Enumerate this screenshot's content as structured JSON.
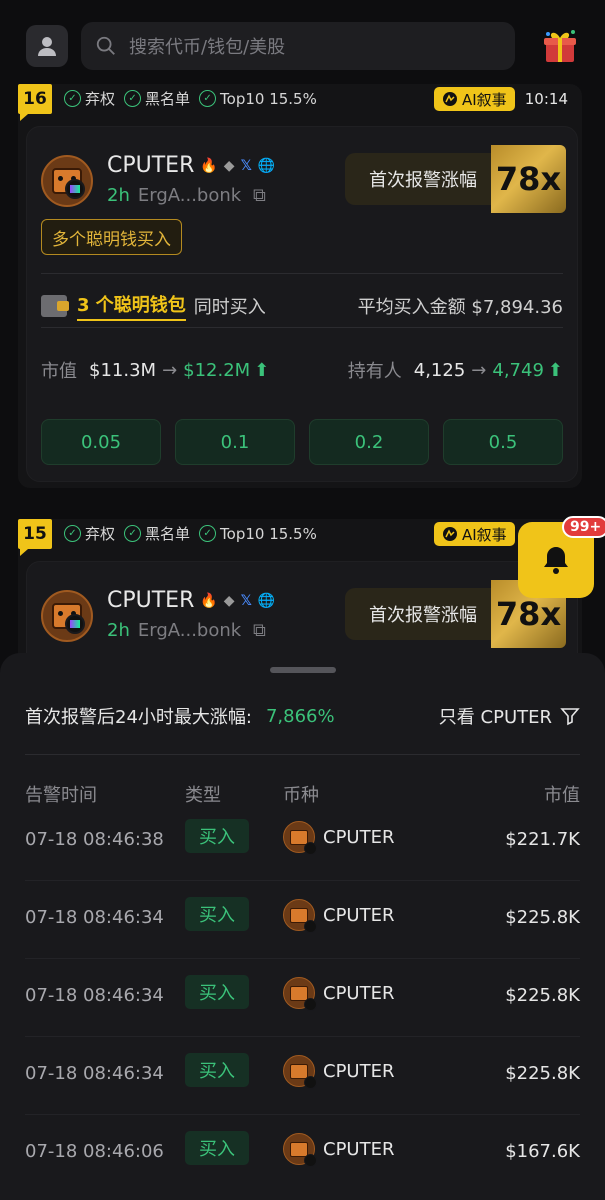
{
  "header": {
    "search_placeholder": "搜索代币/钱包/美股",
    "icons": [
      "user-icon",
      "search-icon",
      "gift-icon"
    ]
  },
  "cards": [
    {
      "rank": "16",
      "checks": [
        "弃权",
        "黑名单",
        "Top10 15.5%"
      ],
      "ai_label": "AI叙事",
      "time": "10:14",
      "token": {
        "name": "CPUTER",
        "age": "2h",
        "address": "ErgA...bonk",
        "tag": "多个聪明钱买入"
      },
      "alert_label": "首次报警涨幅",
      "multiplier": "78x",
      "smart_wallets": "3 个聪明钱包",
      "together_label": "同时买入",
      "avg_label": "平均买入金额",
      "avg_value": "$7,894.36",
      "mc_label": "市值",
      "mc_from": "$11.3M",
      "mc_to": "$12.2M",
      "holders_label": "持有人",
      "holders_from": "4,125",
      "holders_to": "4,749",
      "buy_amounts": [
        "0.05",
        "0.1",
        "0.2",
        "0.5"
      ]
    },
    {
      "rank": "15",
      "checks": [
        "弃权",
        "黑名单",
        "Top10 15.5%"
      ],
      "ai_label": "AI叙事",
      "token": {
        "name": "CPUTER",
        "age": "2h",
        "address": "ErgA...bonk"
      },
      "alert_label": "首次报警涨幅",
      "multiplier": "78x"
    }
  ],
  "notification": {
    "count": "99+"
  },
  "sheet": {
    "title": "首次报警后24小时最大涨幅:",
    "max_gain": "7,866%",
    "filter_label": "只看 CPUTER",
    "columns": [
      "告警时间",
      "类型",
      "币种",
      "市值"
    ],
    "rows": [
      {
        "time": "07-18 08:46:38",
        "type": "买入",
        "coin": "CPUTER",
        "mcap": "$221.7K"
      },
      {
        "time": "07-18 08:46:34",
        "type": "买入",
        "coin": "CPUTER",
        "mcap": "$225.8K"
      },
      {
        "time": "07-18 08:46:34",
        "type": "买入",
        "coin": "CPUTER",
        "mcap": "$225.8K"
      },
      {
        "time": "07-18 08:46:34",
        "type": "买入",
        "coin": "CPUTER",
        "mcap": "$225.8K"
      },
      {
        "time": "07-18 08:46:06",
        "type": "买入",
        "coin": "CPUTER",
        "mcap": "$167.6K"
      }
    ]
  },
  "colors": {
    "accent_yellow": "#f0c419",
    "positive_green": "#3bc27a",
    "background": "#0d0d0f"
  }
}
